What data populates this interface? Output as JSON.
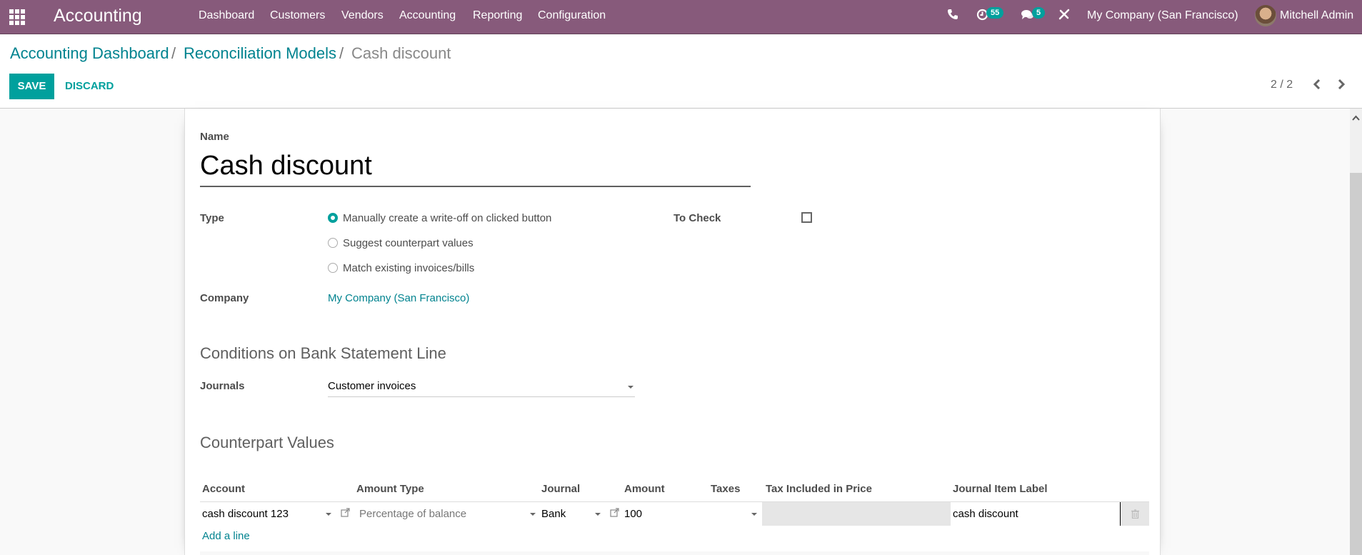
{
  "navbar": {
    "app_name": "Accounting",
    "menu": [
      "Dashboard",
      "Customers",
      "Vendors",
      "Accounting",
      "Reporting",
      "Configuration"
    ],
    "activity_count": "55",
    "message_count": "5",
    "company": "My Company (San Francisco)",
    "user": "Mitchell Admin",
    "icons": {
      "apps": "apps-grid-icon",
      "phone": "phone-icon",
      "activity": "clock-icon",
      "messages": "chat-icon",
      "debug": "tools-icon"
    }
  },
  "breadcrumb": {
    "items": [
      "Accounting Dashboard",
      "Reconciliation Models",
      "Cash discount"
    ],
    "separator": "/"
  },
  "toolbar": {
    "save_label": "SAVE",
    "discard_label": "DISCARD",
    "pager": "2 / 2",
    "prev": "‹",
    "next": "›"
  },
  "form": {
    "name_label": "Name",
    "name_value": "Cash discount",
    "type_label": "Type",
    "type_options": [
      {
        "label": "Manually create a write-off on clicked button",
        "checked": true
      },
      {
        "label": "Suggest counterpart values",
        "checked": false
      },
      {
        "label": "Match existing invoices/bills",
        "checked": false
      }
    ],
    "to_check_label": "To Check",
    "to_check_value": false,
    "company_label": "Company",
    "company_value": "My Company (San Francisco)",
    "conditions_title": "Conditions on Bank Statement Line",
    "journals_label": "Journals",
    "journals_value": "Customer invoices",
    "counterpart_title": "Counterpart Values"
  },
  "counterpart_table": {
    "columns": [
      "Account",
      "Amount Type",
      "Journal",
      "Amount",
      "Taxes",
      "Tax Included in Price",
      "Journal Item Label"
    ],
    "rows": [
      {
        "account": "cash discount 123",
        "amount_type": "Percentage of balance",
        "journal": "Bank",
        "amount": "100",
        "taxes": "",
        "tax_included": "",
        "label": "cash discount"
      }
    ],
    "add_line_label": "Add a line"
  },
  "colors": {
    "brand": "#875a7b",
    "primary": "#00a09d",
    "link": "#00838f"
  }
}
